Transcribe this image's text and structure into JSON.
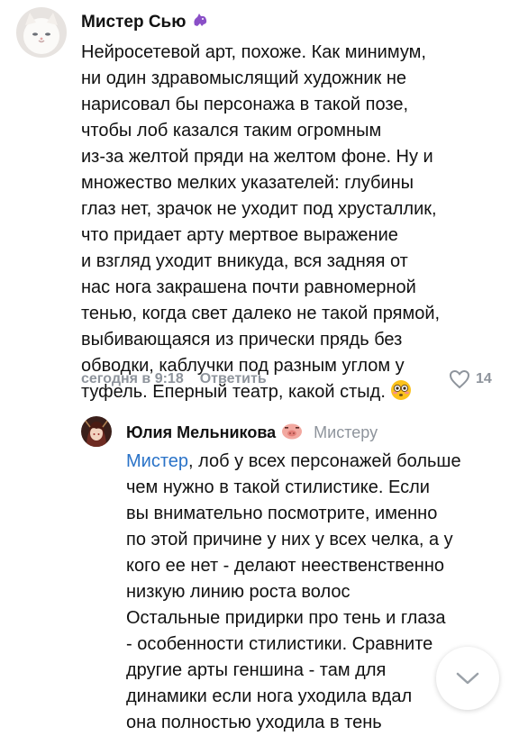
{
  "comments": [
    {
      "author": "Мистер Сью",
      "text": "Нейросетевой арт, похоже. Как минимум,\nни один здравомыслящий художник не\nнарисовал бы персонажа в такой позе,\nчтобы лоб казался таким огромным\nиз-за желтой пряди на желтом фоне. Ну и\nмножество мелких указателей: глубины\nглаз нет, зрачок не уходит под хрусталлик,\nчто придает арту мертвое выражение\nи взгляд уходит вникуда, вся задняя от\nнас нога закрашена почти равномерной\nтенью, когда свет далеко не такой прямой,\nвыбивающаяся из прически прядь без\nобводки, каблучки под разным углом у\nтуфель. Еперный театр, какой стыд.",
      "timestamp": "сегодня в 9:18",
      "reply_label": "Ответить",
      "likes": "14"
    },
    {
      "author": "Юлия Мельникова",
      "reply_to": "Мистеру",
      "mention": "Мистер",
      "text": ", лоб у всех персонажей больше\nчем нужно в такой стилистике. Если\nвы внимательно посмотрите, именно\nпо этой причине у них у всех челка, а у\nкого ее нет - делают неественственно\nнизкую линию роста волос\nОстальные придирки про тень и глаза\n- особенности стилистики. Сравните\nдругие арты геншина - там для\nдинамики если нога уходила вдал\nона полностью уходила в тень"
    }
  ],
  "colors": {
    "link": "#2a73c8",
    "muted": "#8e949c"
  },
  "icons": {
    "author_badge": "purple-dragon-emoji",
    "reply_badge": "pig-face-emoji",
    "text_emoji": "flushed-face-emoji",
    "likes": "heart-outline-icon",
    "scroll": "chevron-down-icon"
  }
}
